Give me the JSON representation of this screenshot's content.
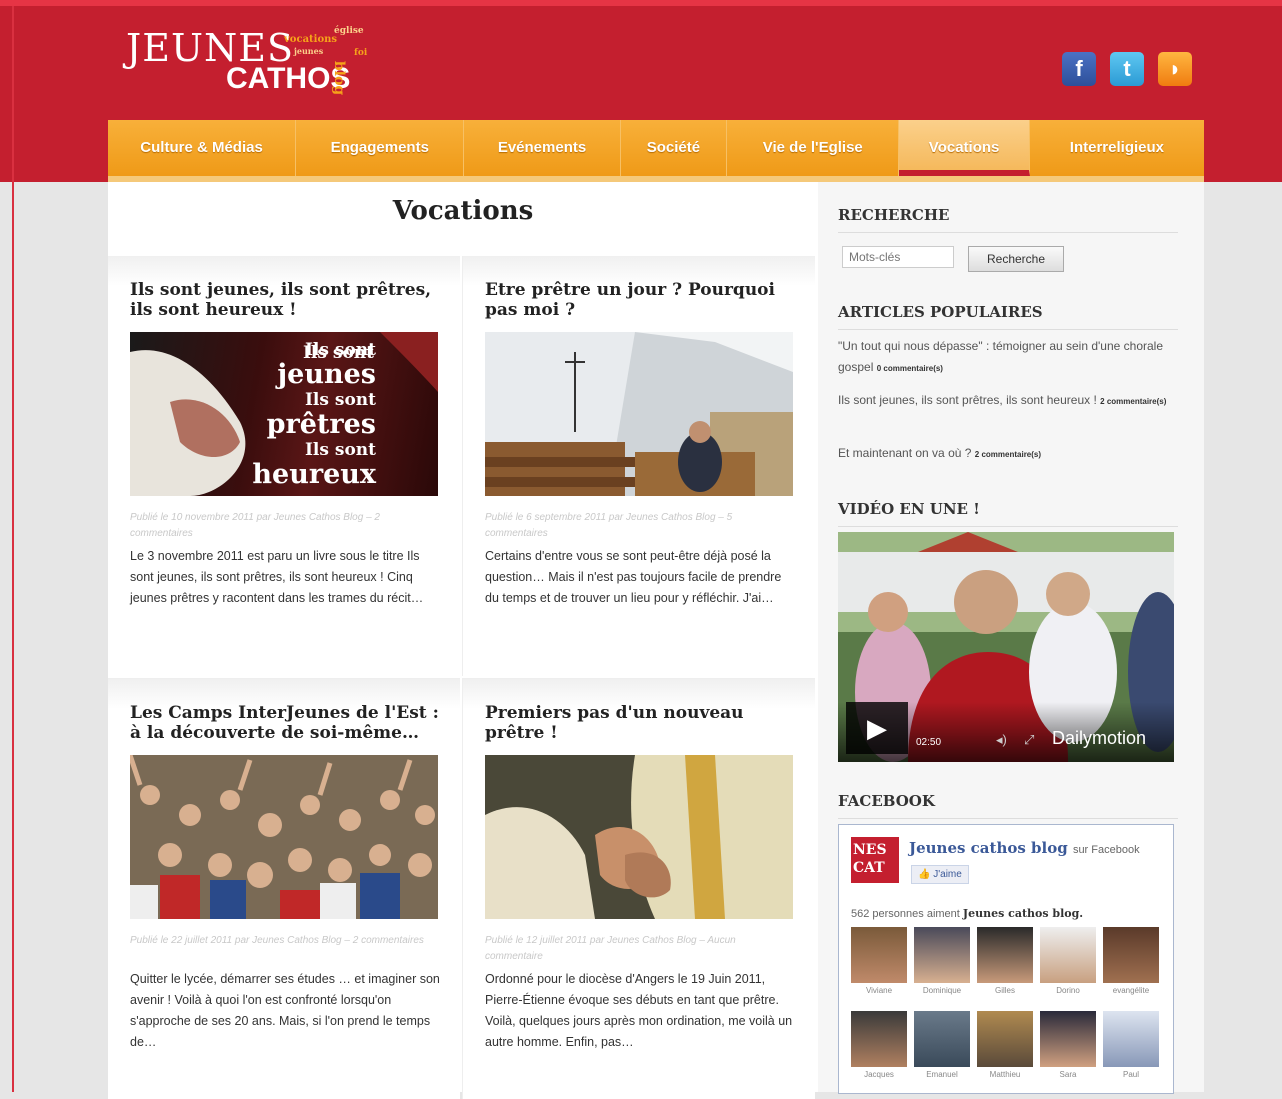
{
  "site": {
    "logo_line1": "JEUNES",
    "logo_line2": "CATHOS",
    "logo_cloud_words": [
      "vocations",
      "église",
      "blog",
      "jeunes",
      "foi"
    ]
  },
  "social": [
    {
      "icon": "facebook-icon",
      "glyph": "f"
    },
    {
      "icon": "twitter-icon",
      "glyph": "t"
    },
    {
      "icon": "rss-icon",
      "glyph": "◗"
    }
  ],
  "nav": [
    {
      "label": "Culture & Médias",
      "active": false
    },
    {
      "label": "Engagements",
      "active": false
    },
    {
      "label": "Evénements",
      "active": false
    },
    {
      "label": "Société",
      "active": false
    },
    {
      "label": "Vie de l'Eglise",
      "active": false
    },
    {
      "label": "Vocations",
      "active": true
    },
    {
      "label": "Interreligieux",
      "active": false
    }
  ],
  "page": {
    "title": "Vocations"
  },
  "posts": [
    {
      "title": "Ils sont jeunes, ils sont prêtres, ils sont heureux !",
      "thumb_text": [
        "Ils sont",
        "jeunes",
        "Ils sont",
        "prêtres",
        "Ils sont",
        "heureux"
      ],
      "meta": "Publié le 10 novembre 2011 par Jeunes Cathos Blog – 2 commentaires",
      "excerpt": "Le 3 novembre 2011 est paru un livre sous le titre Ils sont jeunes, ils sont prêtres, ils sont heureux ! Cinq jeunes prêtres y racontent dans les trames du récit…"
    },
    {
      "title": "Etre prêtre un jour ? Pourquoi pas moi ?",
      "meta": "Publié le 6 septembre 2011 par Jeunes Cathos Blog – 5 commentaires",
      "excerpt": "Certains d'entre vous se sont peut-être déjà posé la question… Mais il n'est pas toujours facile de prendre du temps et de trouver un lieu pour y réfléchir. J'ai…"
    },
    {
      "title": "Les Camps InterJeunes de l'Est : à la découverte de soi-même…",
      "meta": "Publié le 22 juillet 2011 par Jeunes Cathos Blog – 2 commentaires",
      "excerpt": "Quitter le lycée, démarrer ses études … et imaginer son avenir ! Voilà à quoi l'on est confronté lorsqu'on s'approche de ses 20 ans. Mais, si l'on prend le temps de…"
    },
    {
      "title": "Premiers pas d'un nouveau prêtre !",
      "meta": "Publié le 12 juillet 2011 par Jeunes Cathos Blog – Aucun commentaire",
      "excerpt": "Ordonné pour le diocèse d'Angers le 19 Juin 2011, Pierre-Étienne évoque ses débuts en tant que prêtre. Voilà, quelques jours après mon ordination, me voilà un autre homme. Enfin, pas…"
    }
  ],
  "sidebar": {
    "search_heading": "RECHERCHE",
    "search_placeholder": "Mots-clés",
    "search_button": "Recherche",
    "popular_heading": "ARTICLES POPULAIRES",
    "popular": [
      {
        "text": "\"Un tout qui nous dépasse\" : témoigner au sein d'une chorale gospel",
        "count": "0 commentaire(s)"
      },
      {
        "text": "Ils sont jeunes, ils sont prêtres, ils sont heureux !",
        "count": "2 commentaire(s)"
      },
      {
        "text": "Et maintenant on va où ?",
        "count": "2 commentaire(s)"
      }
    ],
    "video_heading": "VIDÉO EN UNE !",
    "video_time": "02:50",
    "video_brand": "Dailymotion",
    "facebook_heading": "FACEBOOK",
    "fb_logo_text": "NES CAT",
    "fb_page_name": "Jeunes cathos blog",
    "fb_on": "sur Facebook",
    "fb_like": "J'aime",
    "fb_count_prefix": "562 personnes aiment",
    "fb_count_page": "Jeunes cathos blog.",
    "fans": [
      "Viviane",
      "Dominique",
      "Gilles",
      "Dorino",
      "evangélite",
      "Jacques",
      "Emanuel",
      "Matthieu",
      "Sara",
      "Paul"
    ]
  }
}
